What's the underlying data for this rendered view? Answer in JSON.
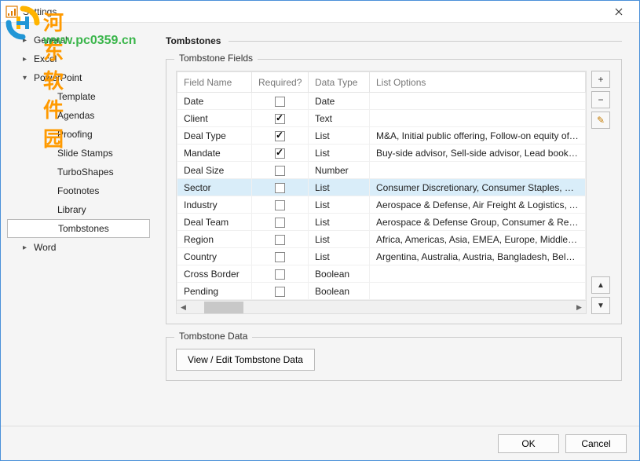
{
  "window": {
    "title": "Settings"
  },
  "watermark": {
    "cn": "河东软件园",
    "url": "www.pc0359.cn"
  },
  "sidebar": {
    "items": [
      {
        "label": "General",
        "level": 0,
        "expanded": false,
        "hasChildren": true
      },
      {
        "label": "Excel",
        "level": 0,
        "expanded": false,
        "hasChildren": true
      },
      {
        "label": "PowerPoint",
        "level": 0,
        "expanded": true,
        "hasChildren": true
      },
      {
        "label": "Template",
        "level": 1
      },
      {
        "label": "Agendas",
        "level": 1
      },
      {
        "label": "Proofing",
        "level": 1
      },
      {
        "label": "Slide Stamps",
        "level": 1
      },
      {
        "label": "TurboShapes",
        "level": 1
      },
      {
        "label": "Footnotes",
        "level": 1
      },
      {
        "label": "Library",
        "level": 1
      },
      {
        "label": "Tombstones",
        "level": 1,
        "selected": true
      },
      {
        "label": "Word",
        "level": 0,
        "expanded": false,
        "hasChildren": true
      }
    ]
  },
  "page": {
    "title": "Tombstones"
  },
  "fieldsGroup": {
    "legend": "Tombstone Fields"
  },
  "table": {
    "headers": {
      "name": "Field Name",
      "required": "Required?",
      "type": "Data Type",
      "options": "List Options"
    },
    "rows": [
      {
        "name": "Date",
        "required": false,
        "type": "Date",
        "options": ""
      },
      {
        "name": "Client",
        "required": true,
        "type": "Text",
        "options": ""
      },
      {
        "name": "Deal Type",
        "required": true,
        "type": "List",
        "options": "M&A, Initial public offering, Follow-on equity offering, Deb"
      },
      {
        "name": "Mandate",
        "required": true,
        "type": "List",
        "options": "Buy-side advisor, Sell-side advisor, Lead bookrunner, Joint"
      },
      {
        "name": "Deal Size",
        "required": false,
        "type": "Number",
        "options": ""
      },
      {
        "name": "Sector",
        "required": false,
        "type": "List",
        "options": "Consumer Discretionary, Consumer Staples, Energy, Financ",
        "selected": true
      },
      {
        "name": "Industry",
        "required": false,
        "type": "List",
        "options": "Aerospace & Defense, Air Freight & Logistics, Airlines, Auto"
      },
      {
        "name": "Deal Team",
        "required": false,
        "type": "List",
        "options": "Aerospace & Defense Group, Consumer & Retail Group, De"
      },
      {
        "name": "Region",
        "required": false,
        "type": "List",
        "options": "Africa, Americas, Asia, EMEA, Europe, Middle East"
      },
      {
        "name": "Country",
        "required": false,
        "type": "List",
        "options": "Argentina, Australia, Austria, Bangladesh, Belgium, Brazil, C"
      },
      {
        "name": "Cross Border",
        "required": false,
        "type": "Boolean",
        "options": ""
      },
      {
        "name": "Pending",
        "required": false,
        "type": "Boolean",
        "options": ""
      }
    ]
  },
  "toolButtons": {
    "add": "+",
    "remove": "−",
    "edit": "✎",
    "up": "▲",
    "down": "▼"
  },
  "dataGroup": {
    "legend": "Tombstone Data",
    "button": "View / Edit Tombstone Data"
  },
  "footer": {
    "ok": "OK",
    "cancel": "Cancel"
  }
}
